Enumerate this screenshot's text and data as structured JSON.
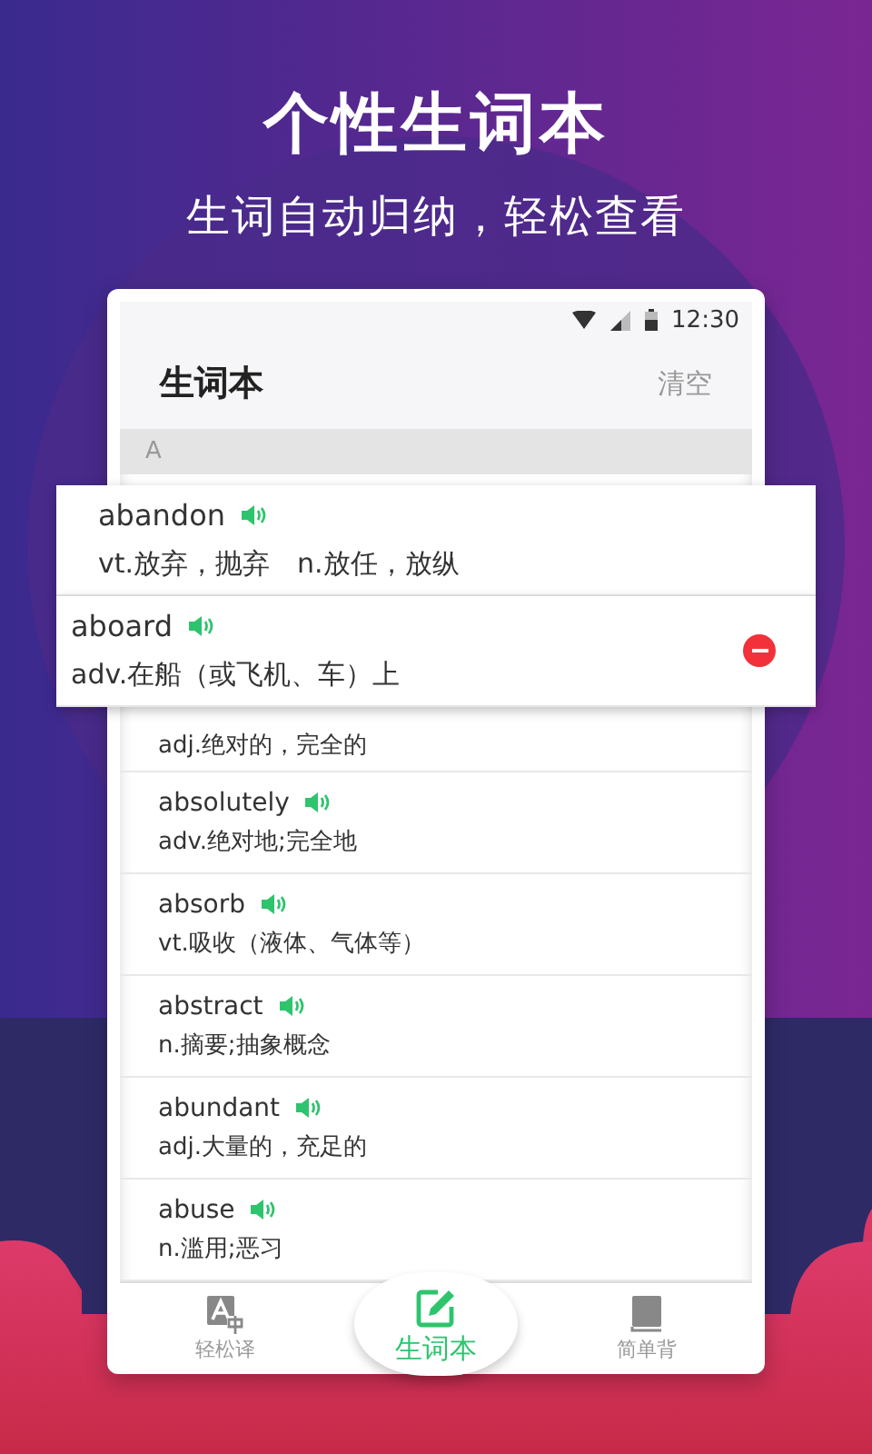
{
  "headline": "个性生词本",
  "subheadline": "生词自动归纳，轻松查看",
  "status_bar": {
    "time": "12:30"
  },
  "app_bar": {
    "title": "生词本",
    "action": "清空"
  },
  "section": {
    "letter": "A"
  },
  "words": [
    {
      "kind": "card",
      "word": "abandon",
      "definition": "vt.放弃，抛弃　n.放任，放纵",
      "show_delete": false
    },
    {
      "kind": "card",
      "word": "aboard",
      "definition": "adv.在船（或飞机、车）上",
      "show_delete": true
    },
    {
      "kind": "partial",
      "definition": "adj.绝对的，完全的"
    },
    {
      "kind": "row",
      "word": "absolutely",
      "definition": "adv.绝对地;完全地"
    },
    {
      "kind": "row",
      "word": "absorb",
      "definition": "vt.吸收（液体、气体等）"
    },
    {
      "kind": "row",
      "word": "abstract",
      "definition": "n.摘要;抽象概念"
    },
    {
      "kind": "row",
      "word": "abundant",
      "definition": "adj.大量的，充足的"
    },
    {
      "kind": "row",
      "word": "abuse",
      "definition": "n.滥用;恶习"
    }
  ],
  "bottom_nav": [
    {
      "kind": "translate",
      "label": "轻松译",
      "selected": false
    },
    {
      "kind": "notebook",
      "label": "生词本",
      "selected": true
    },
    {
      "kind": "book",
      "label": "简单背",
      "selected": false
    }
  ]
}
